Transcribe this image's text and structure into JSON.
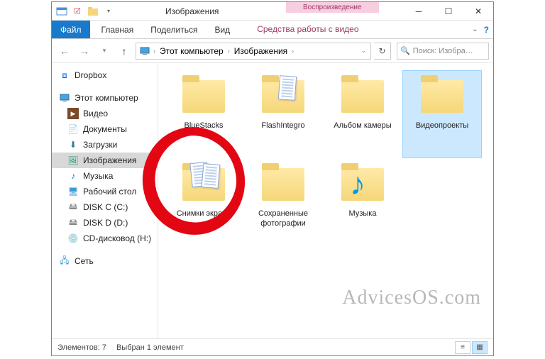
{
  "title": "Изображения",
  "context": {
    "top": "Воспроизведение",
    "tab": "Средства работы с видео"
  },
  "ribbon": {
    "file": "Файл",
    "home": "Главная",
    "share": "Поделиться",
    "view": "Вид"
  },
  "breadcrumb": {
    "pc": "Этот компьютер",
    "folder": "Изображения"
  },
  "search": {
    "placeholder": "Поиск: Изобра…"
  },
  "nav": {
    "dropbox": "Dropbox",
    "pc": "Этот компьютер",
    "videos": "Видео",
    "documents": "Документы",
    "downloads": "Загрузки",
    "pictures": "Изображения",
    "music": "Музыка",
    "desktop": "Рабочий стол",
    "diskc": "DISK C (C:)",
    "diskd": "DISK D (D:)",
    "cd": "CD-дисковод (H:)",
    "network": "Сеть"
  },
  "items": {
    "bluestacks": "BlueStacks",
    "flashintegro": "FlashIntegro",
    "camera": "Альбом камеры",
    "videoprojects": "Видеопроекты",
    "screenshots": "Снимки экрана",
    "savedphotos": "Сохраненные фотографии",
    "music": "Музыка"
  },
  "status": {
    "count": "Элементов: 7",
    "selection": "Выбран 1 элемент"
  },
  "watermark": "AdvicesOS.com"
}
